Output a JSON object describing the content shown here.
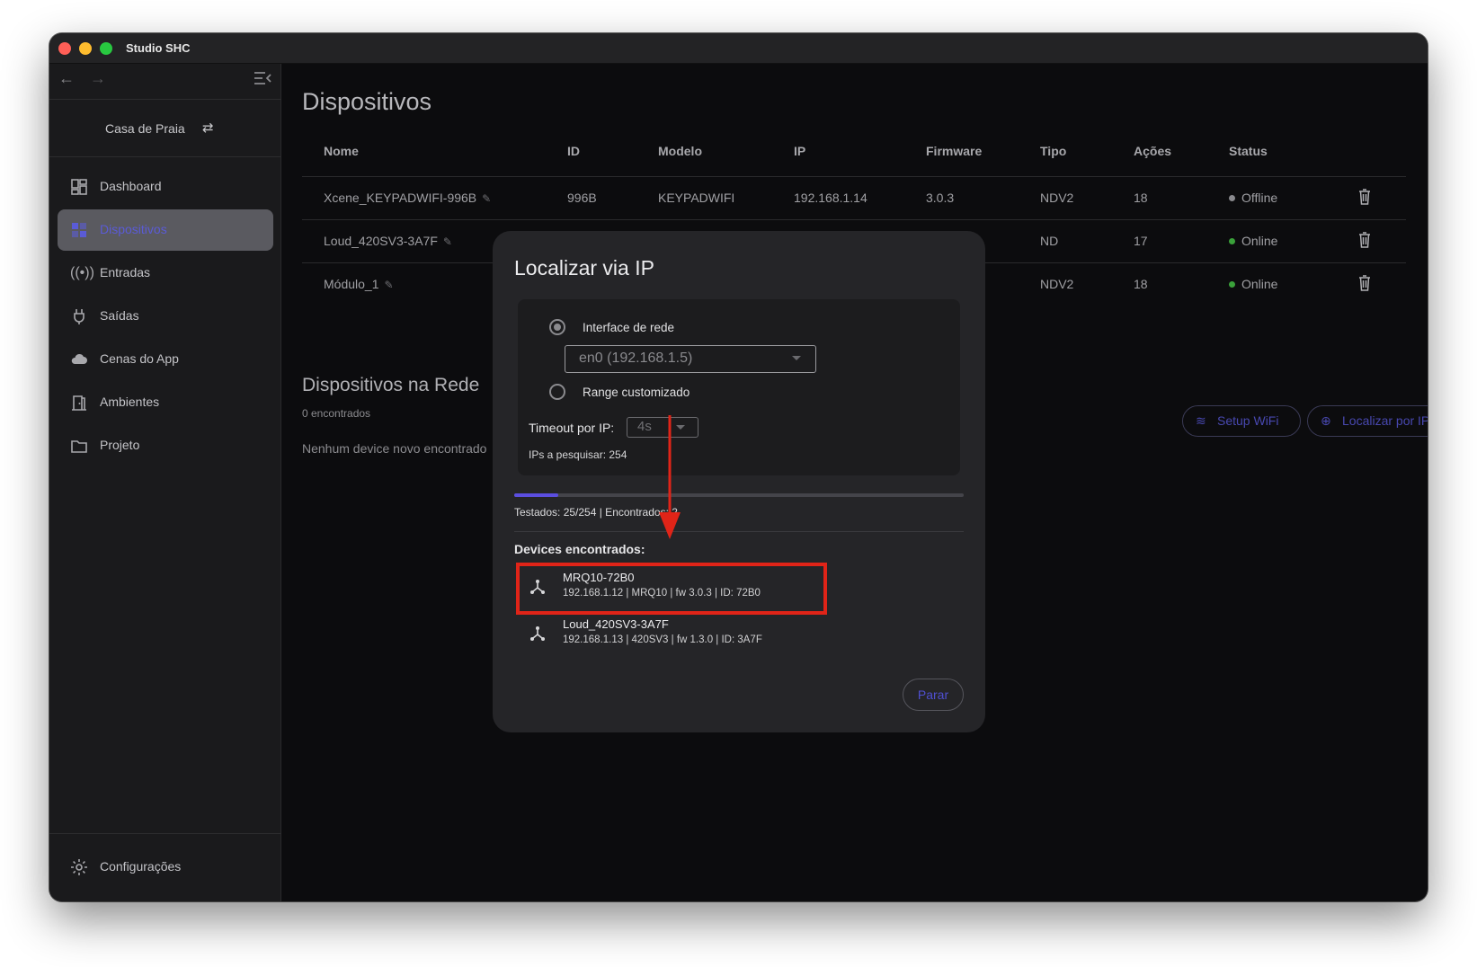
{
  "window": {
    "title": "Studio SHC"
  },
  "sidebar": {
    "house": "Casa de Praia",
    "items": [
      {
        "label": "Dashboard",
        "icon": "dashboard-icon",
        "active": false
      },
      {
        "label": "Dispositivos",
        "icon": "devices-icon",
        "active": true
      },
      {
        "label": "Entradas",
        "icon": "signal-icon",
        "active": false
      },
      {
        "label": "Saídas",
        "icon": "plug-icon",
        "active": false
      },
      {
        "label": "Cenas do App",
        "icon": "cloud-icon",
        "active": false
      },
      {
        "label": "Ambientes",
        "icon": "door-icon",
        "active": false
      },
      {
        "label": "Projeto",
        "icon": "folder-icon",
        "active": false
      }
    ],
    "settings": "Configurações"
  },
  "main": {
    "title": "Dispositivos",
    "columns": [
      "Nome",
      "ID",
      "Modelo",
      "IP",
      "Firmware",
      "Tipo",
      "Ações",
      "Status"
    ],
    "rows": [
      {
        "name": "Xcene_KEYPADWIFI-996B",
        "id": "996B",
        "model": "KEYPADWIFI",
        "ip": "192.168.1.14",
        "firmware": "3.0.3",
        "type": "NDV2",
        "actions": "18",
        "status": "Offline",
        "status_color": "#8a8a8e"
      },
      {
        "name": "Loud_420SV3-3A7F",
        "id": "",
        "model": "",
        "ip": "",
        "firmware": "",
        "type": "ND",
        "actions": "17",
        "status": "Online",
        "status_color": "#3aa13a"
      },
      {
        "name": "Módulo_1",
        "id": "",
        "model": "",
        "ip": "",
        "firmware": "",
        "type": "NDV2",
        "actions": "18",
        "status": "Online",
        "status_color": "#3aa13a"
      }
    ],
    "network_section": {
      "title": "Dispositivos na Rede",
      "count": "0 encontrados",
      "empty": "Nenhum device novo encontrado",
      "setup_wifi": "Setup WiFi",
      "locate_ip": "Localizar por IP"
    }
  },
  "modal": {
    "title": "Localizar via IP",
    "option_interface": "Interface de rede",
    "interface_value": "en0 (192.168.1.5)",
    "option_range": "Range customizado",
    "timeout_label": "Timeout por IP:",
    "timeout_value": "4s",
    "ips_label": "IPs a pesquisar: 254",
    "progress": {
      "tested": 25,
      "total": 254,
      "found": 2
    },
    "progress_text": "Testados: 25/254  |  Encontrados: 2",
    "found_title": "Devices encontrados:",
    "devices": [
      {
        "name": "MRQ10-72B0",
        "info": "192.168.1.12  |  MRQ10  |  fw 3.0.3  |  ID: 72B0"
      },
      {
        "name": "Loud_420SV3-3A7F",
        "info": "192.168.1.13  |  420SV3  |  fw 1.3.0  |  ID: 3A7F"
      }
    ],
    "stop_button": "Parar"
  },
  "colors": {
    "accent": "#5b4ee0",
    "annotation": "#e02418",
    "online": "#3aa13a"
  }
}
